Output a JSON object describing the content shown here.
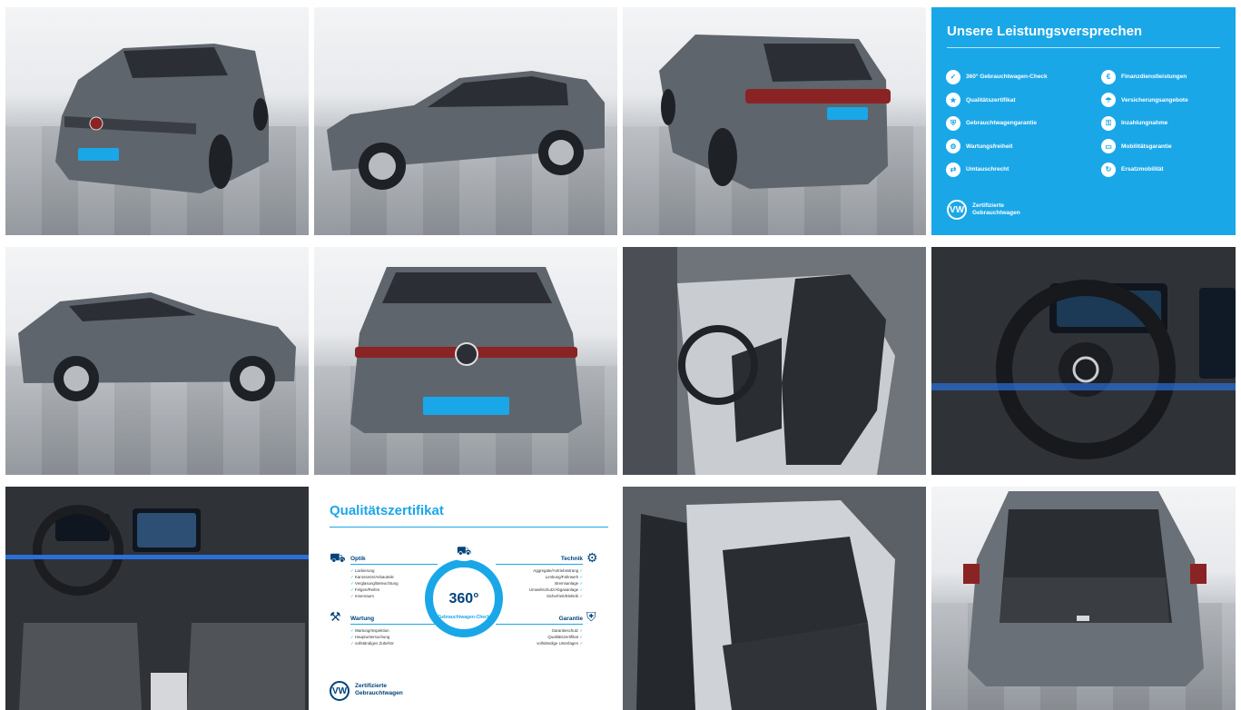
{
  "gallery": {
    "tiles": [
      {
        "kind": "photo",
        "view": "front-left",
        "name": "gallery-photo-front-left"
      },
      {
        "kind": "photo",
        "view": "side-left",
        "name": "gallery-photo-side-left"
      },
      {
        "kind": "photo",
        "view": "rear-left",
        "name": "gallery-photo-rear-left"
      },
      {
        "kind": "promise",
        "name": "gallery-promise-panel"
      },
      {
        "kind": "photo",
        "view": "side-right",
        "name": "gallery-photo-side-right"
      },
      {
        "kind": "photo",
        "view": "front",
        "name": "gallery-photo-front"
      },
      {
        "kind": "interior",
        "view": "front-seats",
        "name": "gallery-photo-front-seats"
      },
      {
        "kind": "interior",
        "view": "steering-wheel",
        "name": "gallery-photo-steering-wheel"
      },
      {
        "kind": "interior",
        "view": "dashboard",
        "name": "gallery-photo-dashboard"
      },
      {
        "kind": "cert",
        "name": "gallery-certificate-panel"
      },
      {
        "kind": "interior",
        "view": "rear-seats",
        "name": "gallery-photo-rear-seats"
      },
      {
        "kind": "photo",
        "view": "trunk",
        "name": "gallery-photo-trunk"
      }
    ]
  },
  "promise": {
    "title": "Unsere Leistungsversprechen",
    "left_items": [
      "360° Gebrauchtwagen-Check",
      "Qualitätszertifikat",
      "Gebrauchtwagengarantie",
      "Wartungsfreiheit",
      "Umtauschrecht"
    ],
    "right_items": [
      "Finanzdienstleistungen",
      "Versicherungsangebote",
      "Inzahlungnahme",
      "Mobilitätsgarantie",
      "Ersatzmobilität"
    ],
    "brand_line1": "Zertifizierte",
    "brand_line2": "Gebrauchtwagen"
  },
  "certificate": {
    "title": "Qualitätszertifikat",
    "ring_number": "360°",
    "ring_label": "Gebrauchtwagen-Check",
    "optik": {
      "heading": "Optik",
      "items": [
        "Lackierung",
        "Karosserie/Anbauteile",
        "Verglasung/Beleuchtung",
        "Felgen/Reifen",
        "Innenraum"
      ]
    },
    "technik": {
      "heading": "Technik",
      "items": [
        "Aggregate/Antriebsstrang",
        "Lenkung/Fahrwerk",
        "Bremsanlage",
        "Umweltschutz/Abgasanlage",
        "Sicherheit/Elektrik"
      ]
    },
    "wartung": {
      "heading": "Wartung",
      "items": [
        "Wartung/Inspektion",
        "Hauptuntersuchung",
        "vollständiges Zubehör"
      ]
    },
    "garantie": {
      "heading": "Garantie",
      "items": [
        "Garantieschutz",
        "Qualitätszertifikat",
        "vollständige Unterlagen"
      ]
    },
    "brand_line1": "Zertifizierte",
    "brand_line2": "Gebrauchtwagen"
  },
  "colors": {
    "accent": "#1aa7e8",
    "navy": "#00437a",
    "car": "#5f656d"
  }
}
